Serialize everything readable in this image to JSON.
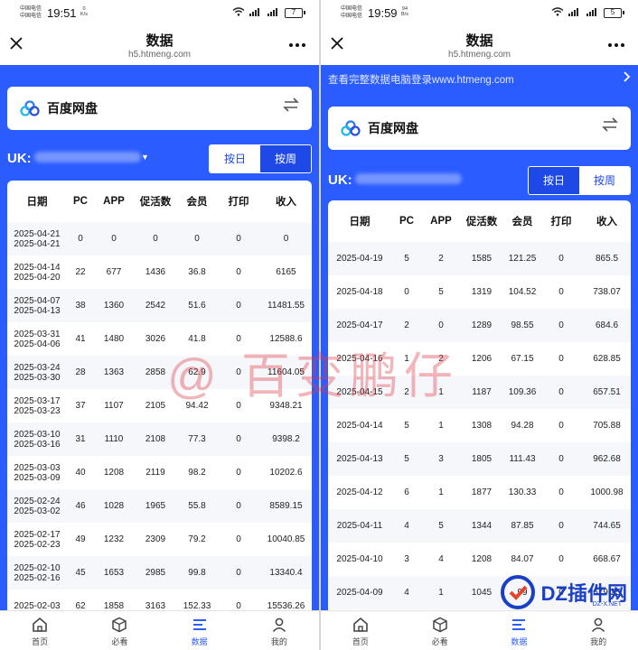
{
  "left": {
    "status": {
      "carrier_line1": "中国电信",
      "carrier_line2": "中国电信",
      "time": "19:51",
      "speed_value": "0",
      "speed_unit": "K/s",
      "battery": "7"
    },
    "header": {
      "title": "数据",
      "url": "h5.htmeng.com"
    },
    "app_card": {
      "name": "百度网盘"
    },
    "uk_label": "UK:",
    "toggle": {
      "day": "按日",
      "week": "按周",
      "active": "week"
    },
    "table": {
      "columns": [
        "日期",
        "PC",
        "APP",
        "促活数",
        "会员",
        "打印",
        "收入"
      ],
      "rows": [
        {
          "date1": "2025-04-21",
          "date2": "2025-04-21",
          "pc": "0",
          "app": "0",
          "active": "0",
          "member": "0",
          "print": "0",
          "income": "0"
        },
        {
          "date1": "2025-04-14",
          "date2": "2025-04-20",
          "pc": "22",
          "app": "677",
          "active": "1436",
          "member": "36.8",
          "print": "0",
          "income": "6165"
        },
        {
          "date1": "2025-04-07",
          "date2": "2025-04-13",
          "pc": "38",
          "app": "1360",
          "active": "2542",
          "member": "51.6",
          "print": "0",
          "income": "11481.55"
        },
        {
          "date1": "2025-03-31",
          "date2": "2025-04-06",
          "pc": "41",
          "app": "1480",
          "active": "3026",
          "member": "41.8",
          "print": "0",
          "income": "12588.6"
        },
        {
          "date1": "2025-03-24",
          "date2": "2025-03-30",
          "pc": "28",
          "app": "1363",
          "active": "2858",
          "member": "62.9",
          "print": "0",
          "income": "11604.05"
        },
        {
          "date1": "2025-03-17",
          "date2": "2025-03-23",
          "pc": "37",
          "app": "1107",
          "active": "2105",
          "member": "94.42",
          "print": "0",
          "income": "9348.21"
        },
        {
          "date1": "2025-03-10",
          "date2": "2025-03-16",
          "pc": "31",
          "app": "1110",
          "active": "2108",
          "member": "77.3",
          "print": "0",
          "income": "9398.2"
        },
        {
          "date1": "2025-03-03",
          "date2": "2025-03-09",
          "pc": "40",
          "app": "1208",
          "active": "2119",
          "member": "98.2",
          "print": "0",
          "income": "10202.6"
        },
        {
          "date1": "2025-02-24",
          "date2": "2025-03-02",
          "pc": "46",
          "app": "1028",
          "active": "1965",
          "member": "55.8",
          "print": "0",
          "income": "8589.15"
        },
        {
          "date1": "2025-02-17",
          "date2": "2025-02-23",
          "pc": "49",
          "app": "1232",
          "active": "2309",
          "member": "79.2",
          "print": "0",
          "income": "10040.85"
        },
        {
          "date1": "2025-02-10",
          "date2": "2025-02-16",
          "pc": "45",
          "app": "1653",
          "active": "2985",
          "member": "99.8",
          "print": "0",
          "income": "13340.4"
        },
        {
          "date1": "2025-02-03",
          "date2": "",
          "pc": "62",
          "app": "1858",
          "active": "3163",
          "member": "152.33",
          "print": "0",
          "income": "15536.26"
        }
      ]
    }
  },
  "right": {
    "status": {
      "carrier_line1": "中国电信",
      "carrier_line2": "中国电信",
      "time": "19:59",
      "speed_value": "94",
      "speed_unit": "B/s",
      "battery": "5"
    },
    "header": {
      "title": "数据",
      "url": "h5.htmeng.com"
    },
    "notice": "查看完整数据电脑登录www.htmeng.com",
    "app_card": {
      "name": "百度网盘"
    },
    "uk_label": "UK:",
    "toggle": {
      "day": "按日",
      "week": "按周",
      "active": "day"
    },
    "table": {
      "columns": [
        "日期",
        "PC",
        "APP",
        "促活数",
        "会员",
        "打印",
        "收入"
      ],
      "rows": [
        {
          "date": "2025-04-19",
          "pc": "5",
          "app": "2",
          "active": "1585",
          "member": "121.25",
          "print": "0",
          "income": "865.5"
        },
        {
          "date": "2025-04-18",
          "pc": "0",
          "app": "5",
          "active": "1319",
          "member": "104.52",
          "print": "0",
          "income": "738.07"
        },
        {
          "date": "2025-04-17",
          "pc": "2",
          "app": "0",
          "active": "1289",
          "member": "98.55",
          "print": "0",
          "income": "684.6"
        },
        {
          "date": "2025-04-16",
          "pc": "1",
          "app": "2",
          "active": "1206",
          "member": "67.15",
          "print": "0",
          "income": "628.85"
        },
        {
          "date": "2025-04-15",
          "pc": "2",
          "app": "1",
          "active": "1187",
          "member": "109.36",
          "print": "0",
          "income": "657.51"
        },
        {
          "date": "2025-04-14",
          "pc": "5",
          "app": "1",
          "active": "1308",
          "member": "94.28",
          "print": "0",
          "income": "705.88"
        },
        {
          "date": "2025-04-13",
          "pc": "5",
          "app": "3",
          "active": "1805",
          "member": "111.43",
          "print": "0",
          "income": "962.68"
        },
        {
          "date": "2025-04-12",
          "pc": "6",
          "app": "1",
          "active": "1877",
          "member": "130.33",
          "print": "0",
          "income": "1000.98"
        },
        {
          "date": "2025-04-11",
          "pc": "4",
          "app": "5",
          "active": "1344",
          "member": "87.85",
          "print": "0",
          "income": "744.65"
        },
        {
          "date": "2025-04-10",
          "pc": "3",
          "app": "4",
          "active": "1208",
          "member": "84.07",
          "print": "0",
          "income": "668.67"
        },
        {
          "date": "2025-04-09",
          "pc": "4",
          "app": "1",
          "active": "1045",
          "member": "99",
          "print": "0",
          "income": "679.25"
        }
      ]
    }
  },
  "nav": [
    {
      "label": "首页",
      "icon": "home-icon"
    },
    {
      "label": "必看",
      "icon": "cube-icon"
    },
    {
      "label": "数据",
      "icon": "data-icon"
    },
    {
      "label": "我的",
      "icon": "user-icon"
    }
  ],
  "nav_active": "数据",
  "watermark": "@ 百变鹏仔",
  "badge": {
    "text": "DZ插件网",
    "sub": "DZ-X.NET"
  },
  "colors": {
    "brand_blue": "#2b5cff",
    "toggle_active": "#1e49e6",
    "watermark": "#dc3c46"
  }
}
